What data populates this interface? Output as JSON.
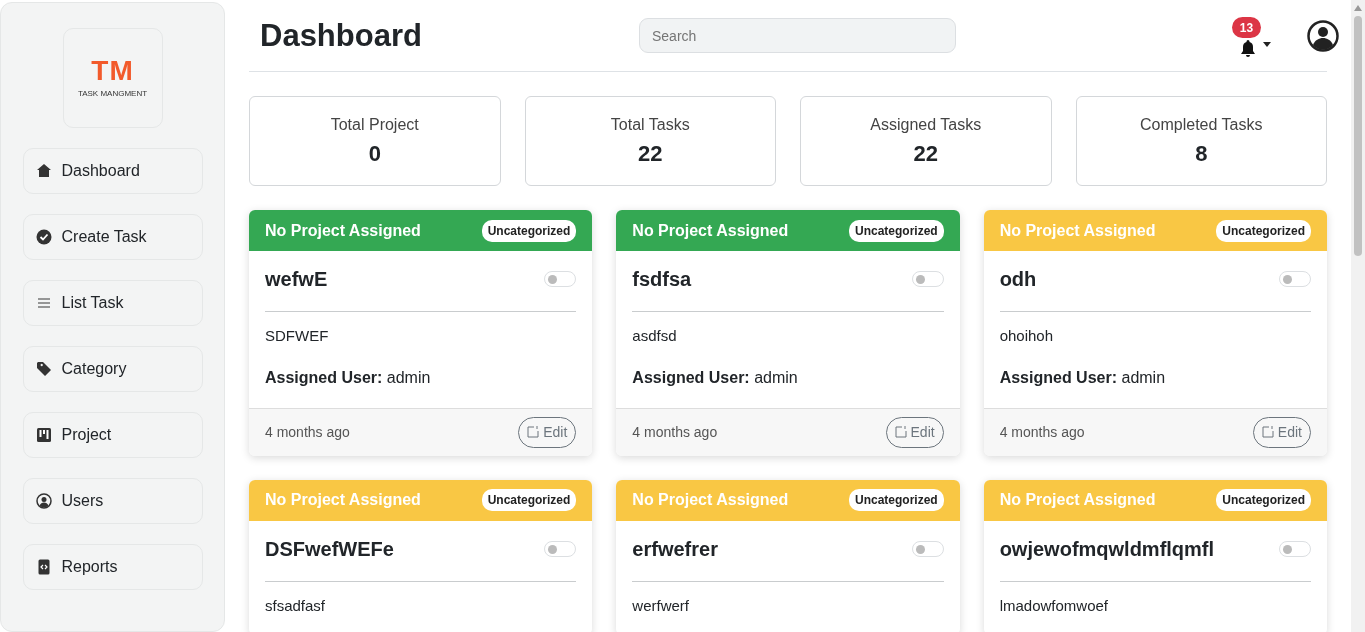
{
  "logo": {
    "mark": "TM",
    "caption": "TASK MANGMENT"
  },
  "sidebar": {
    "items": [
      {
        "label": "Dashboard",
        "selected": false
      },
      {
        "label": "Create Task",
        "selected": false
      },
      {
        "label": "List Task",
        "selected": false
      },
      {
        "label": "Category",
        "selected": false
      },
      {
        "label": "Project",
        "selected": false
      },
      {
        "label": "Users",
        "selected": false
      },
      {
        "label": "Reports",
        "selected": false
      }
    ]
  },
  "header": {
    "title": "Dashboard",
    "search": {
      "placeholder": "Search"
    },
    "notifications": "13"
  },
  "stats": [
    {
      "label": "Total Project",
      "value": "0"
    },
    {
      "label": "Total Tasks",
      "value": "22"
    },
    {
      "label": "Assigned Tasks",
      "value": "22"
    },
    {
      "label": "Completed Tasks",
      "value": "8"
    }
  ],
  "tasks": [
    {
      "project": "No Project Assigned",
      "category": "Uncategorized",
      "color": "#34a853",
      "title": "wefwE",
      "checked": false,
      "description": "SDFWEF",
      "assigned_label": "Assigned User:",
      "assigned_user": "admin",
      "time": "4 months ago",
      "edit": "Edit"
    },
    {
      "project": "No Project Assigned",
      "category": "Uncategorized",
      "color": "#34a853",
      "title": "fsdfsa",
      "checked": false,
      "description": "asdfsd",
      "assigned_label": "Assigned User:",
      "assigned_user": "admin",
      "time": "4 months ago",
      "edit": "Edit"
    },
    {
      "project": "No Project Assigned",
      "category": "Uncategorized",
      "color": "#f9c744",
      "title": "odh",
      "checked": false,
      "description": "ohoihoh",
      "assigned_label": "Assigned User:",
      "assigned_user": "admin",
      "time": "4 months ago",
      "edit": "Edit"
    },
    {
      "project": "No Project Assigned",
      "category": "Uncategorized",
      "color": "#f9c744",
      "title": "DSFwefWEFe",
      "checked": false,
      "description": "sfsadfasf"
    },
    {
      "project": "No Project Assigned",
      "category": "Uncategorized",
      "color": "#f9c744",
      "title": "erfwefrer",
      "checked": false,
      "description": "werfwerf"
    },
    {
      "project": "No Project Assigned",
      "category": "Uncategorized",
      "color": "#f9c744",
      "title": "owjewofmqwldmflqmfl",
      "checked": false,
      "description": "lmadowfomwoef"
    }
  ]
}
